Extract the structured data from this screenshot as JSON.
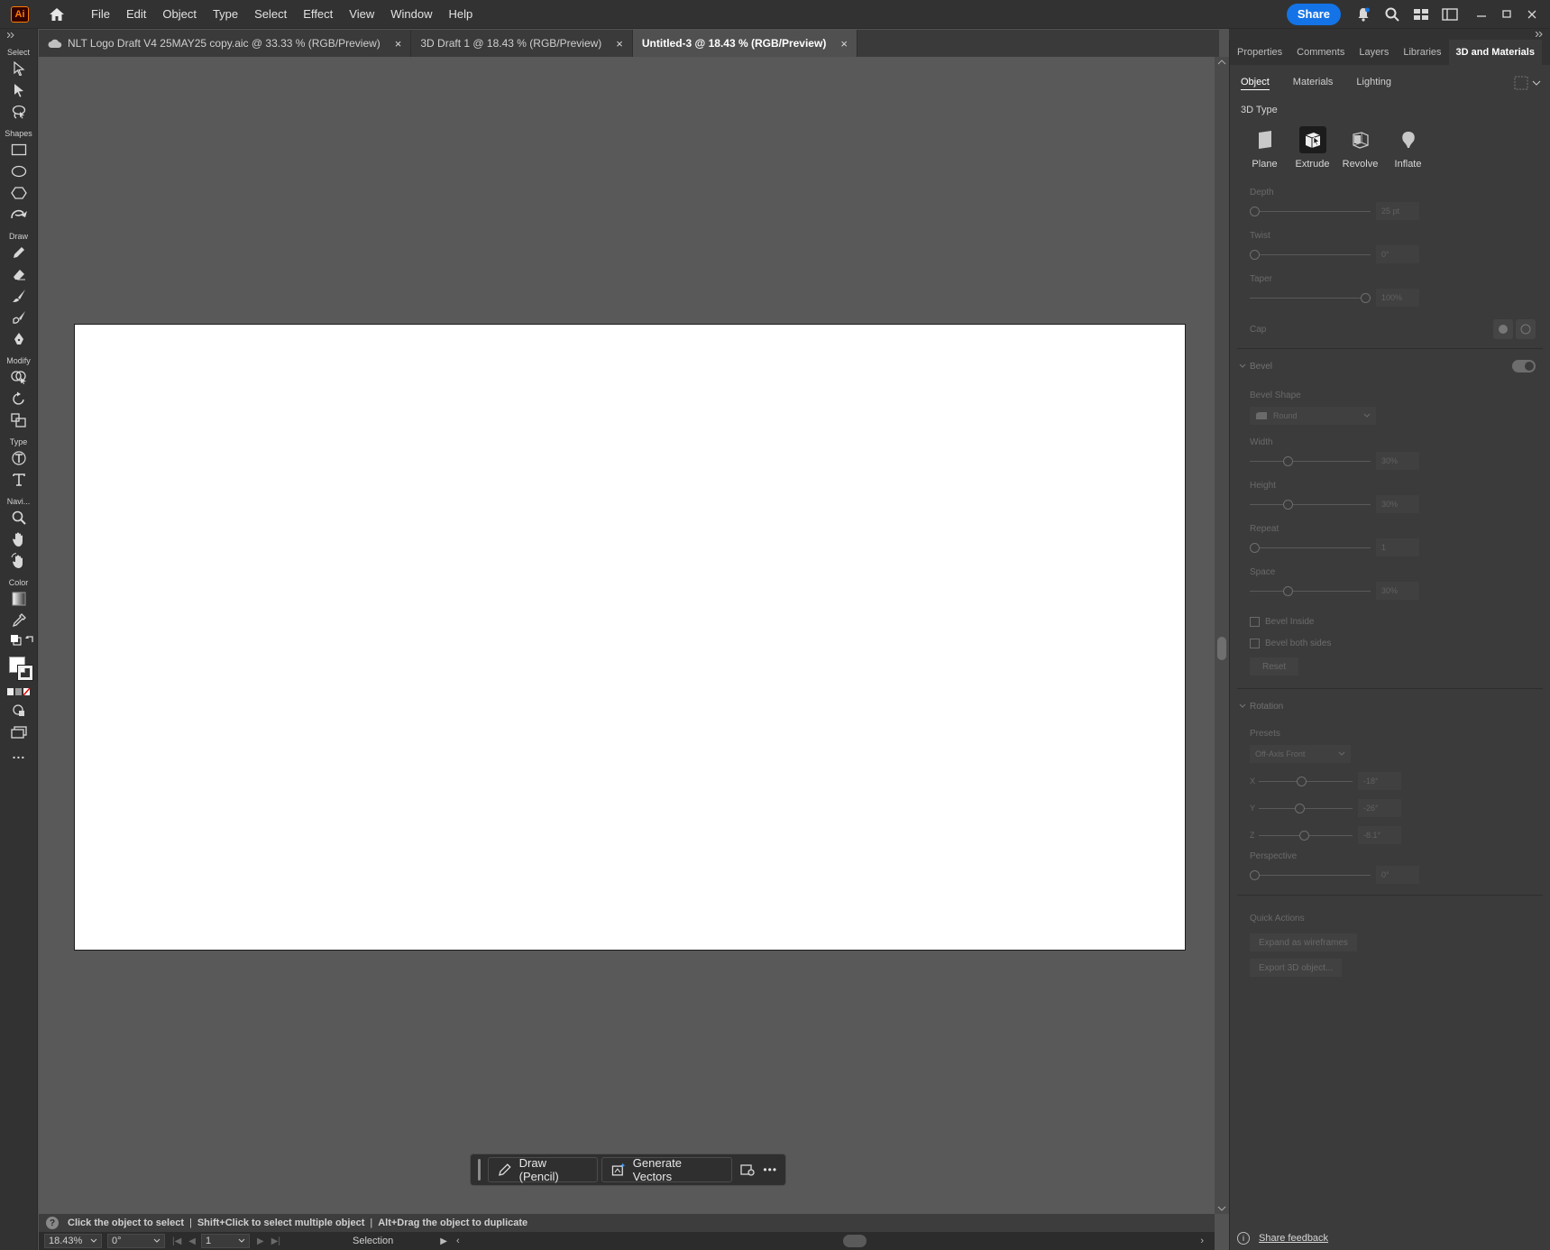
{
  "app": {
    "logo_text": "Ai",
    "accent_color": "#ff7c00",
    "menus": [
      "File",
      "Edit",
      "Object",
      "Type",
      "Select",
      "Effect",
      "View",
      "Window",
      "Help"
    ],
    "share_label": "Share",
    "share_color": "#1473e6"
  },
  "toolbar": {
    "groups": {
      "select": "Select",
      "shapes": "Shapes",
      "draw": "Draw",
      "modify": "Modify",
      "type": "Type",
      "navigate": "Navi...",
      "color": "Color"
    },
    "more_label": "..."
  },
  "tabs": [
    {
      "label": "NLT Logo Draft V4 25MAY25 copy.aic @ 33.33 % (RGB/Preview)",
      "close": "×",
      "cloud": true
    },
    {
      "label": "3D Draft 1 @ 18.43 % (RGB/Preview)",
      "close": "×"
    },
    {
      "label": "Untitled-3 @ 18.43 % (RGB/Preview)",
      "close": "×",
      "active": true
    }
  ],
  "taskbar": {
    "draw_label": "Draw (Pencil)",
    "generate_label": "Generate Vectors",
    "more": "•••"
  },
  "hint": {
    "icon": "?",
    "part1": "Click the object to select",
    "sep": "|",
    "part2": "Shift+Click to select multiple object",
    "part3": "Alt+Drag the object to duplicate"
  },
  "status": {
    "zoom": "18.43%",
    "rotation": "0°",
    "artboard": "1",
    "tool": "Selection"
  },
  "panel": {
    "tabs": [
      "Properties",
      "Comments",
      "Layers",
      "Libraries",
      "3D and Materials"
    ],
    "sub_tabs": [
      "Object",
      "Materials",
      "Lighting"
    ],
    "type_heading": "3D Type",
    "types": [
      "Plane",
      "Extrude",
      "Revolve",
      "Inflate"
    ],
    "depth": {
      "label": "Depth",
      "value": "25 pt",
      "position": 0.0
    },
    "twist": {
      "label": "Twist",
      "value": "0°",
      "position": 0.0
    },
    "taper": {
      "label": "Taper",
      "value": "100%",
      "position": 1.0
    },
    "cap_label": "Cap",
    "bevel": {
      "label": "Bevel",
      "shape_label": "Bevel Shape",
      "shape_value": "Round",
      "width": {
        "label": "Width",
        "value": "30%",
        "position": 0.3
      },
      "height": {
        "label": "Height",
        "value": "30%",
        "position": 0.3
      },
      "repeat": {
        "label": "Repeat",
        "value": "1",
        "position": 0.0
      },
      "space": {
        "label": "Space",
        "value": "30%",
        "position": 0.3
      },
      "inside_label": "Bevel Inside",
      "both_label": "Bevel both sides",
      "reset_label": "Reset"
    },
    "rotation": {
      "label": "Rotation",
      "presets_label": "Presets",
      "presets_value": "Off-Axis Front",
      "x": {
        "label": "X",
        "value": "-18°",
        "position": 0.45
      },
      "y": {
        "label": "Y",
        "value": "-26°",
        "position": 0.43
      },
      "z": {
        "label": "Z",
        "value": "-8.1°",
        "position": 0.48
      },
      "perspective": {
        "label": "Perspective",
        "value": "0°",
        "position": 0.0
      }
    },
    "quick_actions": {
      "label": "Quick Actions",
      "expand": "Expand as wireframes",
      "export": "Export 3D object..."
    },
    "feedback_label": "Share feedback"
  }
}
